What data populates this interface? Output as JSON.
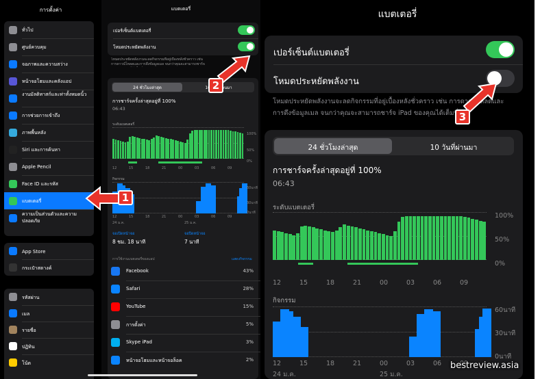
{
  "panel1": {
    "title": "การตั้งค่า",
    "group1": [
      {
        "label": "ทั่วไป",
        "icon": "gear-icon",
        "color": "#8e8e93"
      },
      {
        "label": "ศูนย์ควบคุม",
        "icon": "switches-icon",
        "color": "#8e8e93"
      },
      {
        "label": "จอภาพและความสว่าง",
        "icon": "brightness-icon",
        "color": "#0a7aff"
      },
      {
        "label": "หน้าจอโฮมและคลังแอป",
        "icon": "grid-icon",
        "color": "#5856d6"
      },
      {
        "label": "งานมัลติทาสก์และท่าทั้งหมดนิ้ว",
        "icon": "multitask-icon",
        "color": "#0a7aff"
      },
      {
        "label": "การช่วยการเข้าถึง",
        "icon": "accessibility-icon",
        "color": "#0a7aff"
      },
      {
        "label": "ภาพพื้นหลัง",
        "icon": "flower-icon",
        "color": "#35aadc"
      },
      {
        "label": "Siri และการค้นหา",
        "icon": "siri-icon",
        "color": "#222"
      },
      {
        "label": "Apple Pencil",
        "icon": "pencil-icon",
        "color": "#8e8e93"
      },
      {
        "label": "Face ID และรหัส",
        "icon": "faceid-icon",
        "color": "#34c759"
      },
      {
        "label": "แบตเตอรี่",
        "icon": "battery-icon",
        "color": "#34c759",
        "selected": true
      },
      {
        "label": "ความเป็นส่วนตัวและความปลอดภัย",
        "icon": "hand-icon",
        "color": "#0a7aff"
      }
    ],
    "group2": [
      {
        "label": "App Store",
        "icon": "appstore-icon",
        "color": "#0a7aff"
      },
      {
        "label": "กระเป๋าสตางค์",
        "icon": "wallet-icon",
        "color": "#333"
      }
    ],
    "group3": [
      {
        "label": "รหัสผ่าน",
        "icon": "key-icon",
        "color": "#8e8e93"
      },
      {
        "label": "เมล",
        "icon": "mail-icon",
        "color": "#0a7aff"
      },
      {
        "label": "รายชื่อ",
        "icon": "contacts-icon",
        "color": "#a2845e"
      },
      {
        "label": "ปฏิทิน",
        "icon": "calendar-icon",
        "color": "#fff"
      },
      {
        "label": "โน้ต",
        "icon": "notes-icon",
        "color": "#ffcc00"
      }
    ]
  },
  "panel2": {
    "title": "แบตเตอรี่",
    "toggle1_label": "เปอร์เซ็นต์แบตเตอรี่",
    "toggle2_label": "โหมดประหยัดพลังงาน",
    "toggle1_on": true,
    "toggle2_on": true,
    "note": "โหมดประหยัดพลังงานจะลดกิจกรรมที่อยู่เบื้องหลังชั่วคราว เช่น การดาวน์โหลดและการดึงข้อมูลเมล จนกว่าคุณจะสามารถชาร์จ iPad ของคุณได้เต็มที่",
    "seg_left": "24 ชั่วโมงล่าสุด",
    "seg_right": "10 วันที่ผ่านมา",
    "last_charge": "การชาร์จครั้งล่าสุดอยู่ที่ 100%",
    "last_charge_time": "06:43",
    "battery_level_label": "ระดับแบตเตอรี่",
    "activity_label": "กิจกรรม",
    "x_ticks": [
      "12",
      "15",
      "18",
      "21",
      "00",
      "03",
      "06",
      "09"
    ],
    "y_pct": [
      "100%",
      "50%",
      "0%"
    ],
    "y_min": [
      "60นาที",
      "30นาที",
      "0นาที"
    ],
    "date1": "24 ม.ค.",
    "date2": "25 ม.ค.",
    "screen_on_label": "จอเปิดหน้าจอ",
    "screen_on_value": "8 ชม. 18 นาที",
    "screen_off_label": "จอปิดหน้าจอ",
    "screen_off_value": "7 นาที",
    "usage_header": "การใช้งานแบตเตอรี่ของแอป",
    "show_activity": "แสดงกิจกรรม",
    "apps": [
      {
        "name": "Facebook",
        "pct": "43%",
        "icon": "facebook-icon",
        "color": "#1877f2"
      },
      {
        "name": "Safari",
        "pct": "28%",
        "icon": "safari-icon",
        "color": "#0a84ff"
      },
      {
        "name": "YouTube",
        "pct": "15%",
        "icon": "youtube-icon",
        "color": "#ff0000"
      },
      {
        "name": "การตั้งค่า",
        "pct": "5%",
        "icon": "gear-icon",
        "color": "#8e8e93"
      },
      {
        "name": "Skype iPad",
        "pct": "3%",
        "icon": "skype-icon",
        "color": "#00aff0"
      },
      {
        "name": "หน้าจอโฮมและหน้าจอล็อค",
        "pct": "2%",
        "icon": "home-icon",
        "color": "#0a84ff"
      }
    ]
  },
  "panel3": {
    "title": "แบตเตอรี่",
    "toggle1_label": "เปอร์เซ็นต์แบตเตอรี่",
    "toggle2_label": "โหมดประหยัดพลังงาน",
    "toggle1_on": true,
    "toggle2_on": false,
    "note": "โหมดประหยัดพลังงานจะลดกิจกรรมที่อยู่เบื้องหลังชั่วคราว เช่น การดาวน์โหลดและการดึงข้อมูลเมล จนกว่าคุณจะสามารถชาร์จ iPad ของคุณได้เต็มที่",
    "seg_left": "24 ชั่วโมงล่าสุด",
    "seg_right": "10 วันที่ผ่านมา",
    "last_charge": "การชาร์จครั้งล่าสุดอยู่ที่ 100%",
    "last_charge_time": "06:43",
    "battery_level_label": "ระดับแบตเตอรี่",
    "activity_label": "กิจกรรม",
    "date1": "24 ม.ค.",
    "date2": "25 ม.ค."
  },
  "annotations": {
    "badge1": "1",
    "badge2": "2",
    "badge3": "3",
    "arrow_color": "#e8332a"
  },
  "watermark": "bestreview.asia"
}
